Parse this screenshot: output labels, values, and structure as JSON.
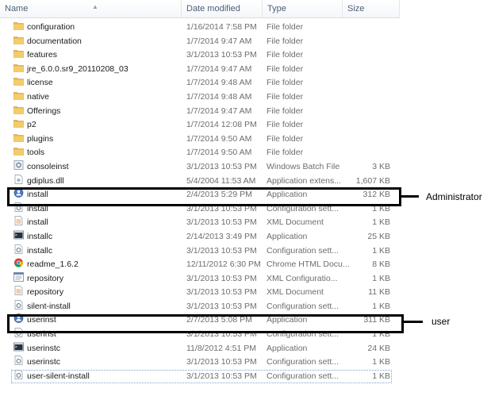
{
  "columns": {
    "name": "Name",
    "date": "Date modified",
    "type": "Type",
    "size": "Size"
  },
  "files": [
    {
      "name": "configuration",
      "date": "1/16/2014 7:58 PM",
      "type": "File folder",
      "size": "",
      "icon": "folder-icon"
    },
    {
      "name": "documentation",
      "date": "1/7/2014 9:47 AM",
      "type": "File folder",
      "size": "",
      "icon": "folder-icon"
    },
    {
      "name": "features",
      "date": "3/1/2013 10:53 PM",
      "type": "File folder",
      "size": "",
      "icon": "folder-icon"
    },
    {
      "name": "jre_6.0.0.sr9_20110208_03",
      "date": "1/7/2014 9:47 AM",
      "type": "File folder",
      "size": "",
      "icon": "folder-icon"
    },
    {
      "name": "license",
      "date": "1/7/2014 9:48 AM",
      "type": "File folder",
      "size": "",
      "icon": "folder-icon"
    },
    {
      "name": "native",
      "date": "1/7/2014 9:48 AM",
      "type": "File folder",
      "size": "",
      "icon": "folder-icon"
    },
    {
      "name": "Offerings",
      "date": "1/7/2014 9:47 AM",
      "type": "File folder",
      "size": "",
      "icon": "folder-icon"
    },
    {
      "name": "p2",
      "date": "1/7/2014 12:08 PM",
      "type": "File folder",
      "size": "",
      "icon": "folder-icon"
    },
    {
      "name": "plugins",
      "date": "1/7/2014 9:50 AM",
      "type": "File folder",
      "size": "",
      "icon": "folder-icon"
    },
    {
      "name": "tools",
      "date": "1/7/2014 9:50 AM",
      "type": "File folder",
      "size": "",
      "icon": "folder-icon"
    },
    {
      "name": "consoleinst",
      "date": "3/1/2013 10:53 PM",
      "type": "Windows Batch File",
      "size": "3 KB",
      "icon": "batch-file-icon"
    },
    {
      "name": "gdiplus.dll",
      "date": "5/4/2004 11:53 AM",
      "type": "Application extens...",
      "size": "1,607 KB",
      "icon": "dll-icon"
    },
    {
      "name": "install",
      "date": "2/4/2013 5:29 PM",
      "type": "Application",
      "size": "312 KB",
      "icon": "installer-app-icon"
    },
    {
      "name": "install",
      "date": "3/1/2013 10:53 PM",
      "type": "Configuration sett...",
      "size": "1 KB",
      "icon": "config-file-icon"
    },
    {
      "name": "install",
      "date": "3/1/2013 10:53 PM",
      "type": "XML Document",
      "size": "1 KB",
      "icon": "xml-document-icon"
    },
    {
      "name": "installc",
      "date": "2/14/2013 3:49 PM",
      "type": "Application",
      "size": "25 KB",
      "icon": "console-app-icon"
    },
    {
      "name": "installc",
      "date": "3/1/2013 10:53 PM",
      "type": "Configuration sett...",
      "size": "1 KB",
      "icon": "config-file-icon"
    },
    {
      "name": "readme_1.6.2",
      "date": "12/11/2012 6:30 PM",
      "type": "Chrome HTML Docu...",
      "size": "8 KB",
      "icon": "chrome-html-icon"
    },
    {
      "name": "repository",
      "date": "3/1/2013 10:53 PM",
      "type": "XML Configuratio...",
      "size": "1 KB",
      "icon": "xml-config-icon"
    },
    {
      "name": "repository",
      "date": "3/1/2013 10:53 PM",
      "type": "XML Document",
      "size": "11 KB",
      "icon": "xml-document-icon"
    },
    {
      "name": "silent-install",
      "date": "3/1/2013 10:53 PM",
      "type": "Configuration sett...",
      "size": "1 KB",
      "icon": "config-file-icon"
    },
    {
      "name": "userinst",
      "date": "2/7/2013 5:08 PM",
      "type": "Application",
      "size": "311 KB",
      "icon": "installer-app-icon"
    },
    {
      "name": "userinst",
      "date": "3/1/2013 10:53 PM",
      "type": "Configuration sett...",
      "size": "1 KB",
      "icon": "config-file-icon"
    },
    {
      "name": "userinstc",
      "date": "11/8/2012 4:51 PM",
      "type": "Application",
      "size": "24 KB",
      "icon": "console-app-icon"
    },
    {
      "name": "userinstc",
      "date": "3/1/2013 10:53 PM",
      "type": "Configuration sett...",
      "size": "1 KB",
      "icon": "config-file-icon"
    },
    {
      "name": "user-silent-install",
      "date": "3/1/2013 10:53 PM",
      "type": "Configuration sett...",
      "size": "1 KB",
      "icon": "config-file-icon"
    }
  ],
  "annotations": {
    "admin_label": "Administrator",
    "user_label": "user"
  },
  "colors": {
    "folder": "#e8b84a",
    "header_text": "#4c607a",
    "detail_text": "#6d6d6d",
    "annotation": "#000000"
  }
}
